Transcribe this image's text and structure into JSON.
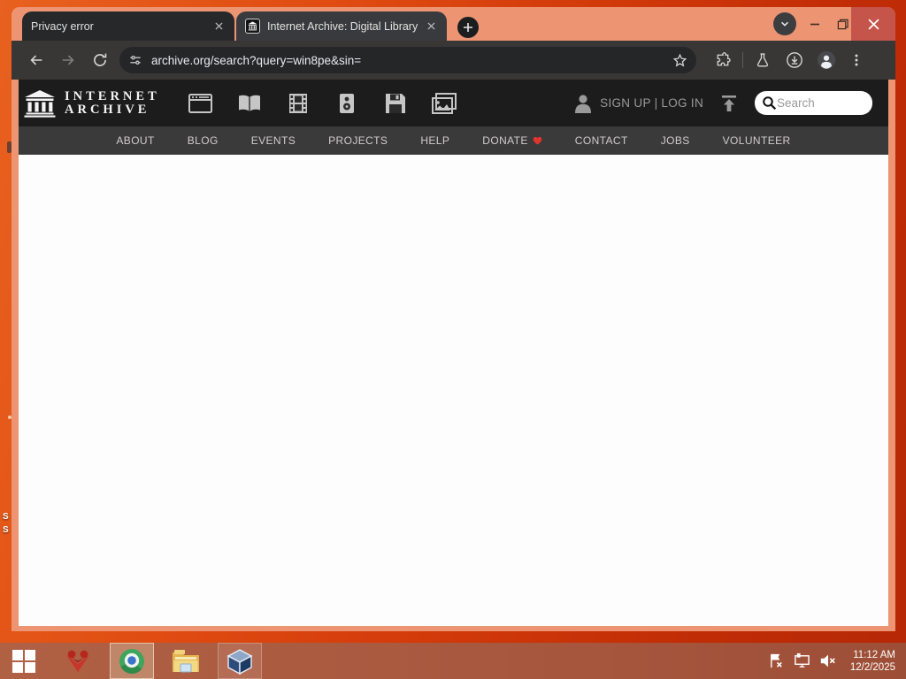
{
  "browser": {
    "tabs": [
      {
        "title": "Privacy error",
        "active": false
      },
      {
        "title": "Internet Archive: Digital Library",
        "active": true
      }
    ],
    "url": "archive.org/search?query=win8pe&sin=",
    "toolbar_icons": [
      "back-arrow",
      "forward-arrow",
      "reload",
      "site-info-tune",
      "bookmark-star",
      "extensions-puzzle",
      "labs-flask",
      "downloads",
      "profile-avatar",
      "kebab-menu"
    ],
    "window_controls": [
      "tab-search-chevron",
      "minimize",
      "restore",
      "close"
    ]
  },
  "page": {
    "header": {
      "logo_line1": "INTERNET",
      "logo_line2": "ARCHIVE",
      "media_icons": [
        "web",
        "texts",
        "video",
        "audio",
        "software",
        "images"
      ],
      "signup_login": "SIGN UP | LOG IN",
      "search_placeholder": "Search"
    },
    "nav": {
      "items": [
        "ABOUT",
        "BLOG",
        "EVENTS",
        "PROJECTS",
        "HELP",
        "DONATE",
        "CONTACT",
        "JOBS",
        "VOLUNTEER"
      ],
      "donate_has_heart": true
    }
  },
  "taskbar": {
    "apps": [
      "windows-start",
      "red-app",
      "chrome-browser",
      "file-explorer",
      "virtualbox"
    ],
    "tray_icons": [
      "flag-alert",
      "network-display",
      "volume-muted"
    ],
    "clock": {
      "time": "11:12 AM",
      "date": "12/2/2025"
    }
  },
  "desktop": {
    "icon_label_fragments": [
      "S",
      "S"
    ]
  },
  "colors": {
    "desktop_orange": "#d84310",
    "window_frame": "#ed9472",
    "toolbar": "#393736",
    "ia_header": "#1c1c1c",
    "ia_nav": "#3b3a3a",
    "donate_heart": "#e5342c",
    "close_button": "#c5544a",
    "taskbar": "#aa5a42"
  }
}
